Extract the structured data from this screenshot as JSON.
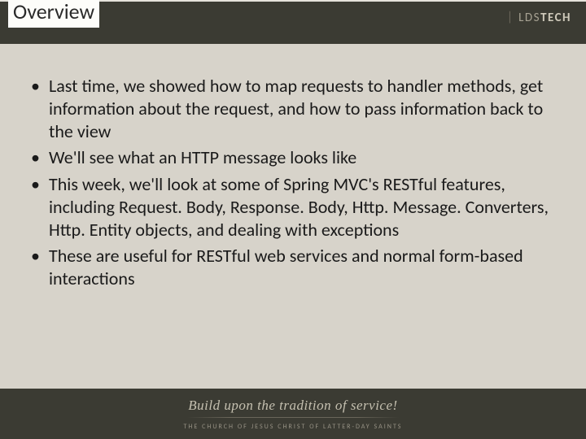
{
  "header": {
    "title": "Overview",
    "logo": {
      "separator": "|",
      "part1": "LDS",
      "part2": "TECH"
    }
  },
  "bullets": [
    "Last time, we showed how to map requests to handler methods, get information about the request, and how to pass information back to the view",
    "We'll see what an HTTP message looks like",
    "This week, we'll look at some of Spring MVC's RESTful features, including Request. Body, Response. Body, Http. Message. Converters, Http. Entity objects, and dealing with exceptions",
    "These are useful for RESTful web services and normal form-based interactions"
  ],
  "footer": {
    "tagline": "Build upon the tradition of service!",
    "subline": "The Church of Jesus Christ of Latter-day Saints"
  }
}
